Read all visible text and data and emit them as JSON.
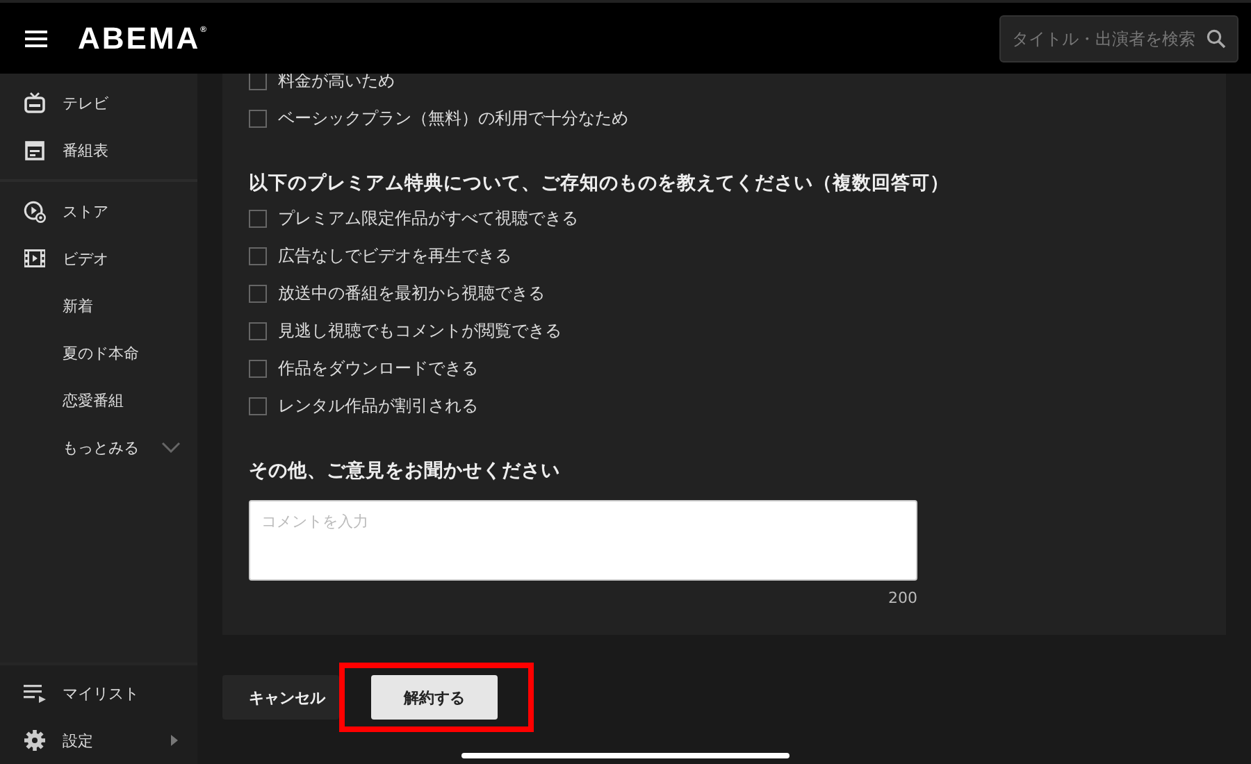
{
  "header": {
    "logo": "ABEMA$^{®}$",
    "search": {
      "placeholder": "タイトル・出演者を検索"
    }
  },
  "sidebar": {
    "sections": [
      {
        "items": [
          {
            "label": "テレビ",
            "kind": "main"
          },
          {
            "label": "番組表",
            "kind": "main"
          }
        ]
      },
      {
        "items": [
          {
            "label": "ストア",
            "kind": "main"
          },
          {
            "label": "ビデオ",
            "kind": "main"
          },
          {
            "label": "新着",
            "kind": "sub"
          },
          {
            "label": "夏のド本命",
            "kind": "sub"
          },
          {
            "label": "恋愛番組",
            "kind": "sub"
          },
          {
            "label": "もっとみる",
            "kind": "more",
            "expanded": false
          }
        ]
      }
    ],
    "footer_items": [
      {
        "label": "マイリスト",
        "submenu": false
      },
      {
        "label": "設定",
        "submenu": true
      }
    ]
  },
  "survey": {
    "reason_options": [
      {
        "label": "料金が高いため",
        "checked": false
      },
      {
        "label": "ベーシックプラン（無料）の利用で十分なため",
        "checked": false
      }
    ],
    "premium_question": {
      "heading": "以下のプレミアム特典について、ご存知のものを教えてください（複数回答可）",
      "options": [
        {
          "label": "プレミアム限定作品がすべて視聴できる",
          "checked": false
        },
        {
          "label": "広告なしでビデオを再生できる",
          "checked": false
        },
        {
          "label": "放送中の番組を最初から視聴できる",
          "checked": false
        },
        {
          "label": "見逃し視聴でもコメントが閲覧できる",
          "checked": false
        },
        {
          "label": "作品をダウンロードできる",
          "checked": false
        },
        {
          "label": "レンタル作品が割引される",
          "checked": false
        }
      ]
    },
    "comment": {
      "heading": "その他、ご意見をお聞かせください",
      "placeholder": "コメントを入力",
      "counter": "200"
    }
  },
  "buttons": {
    "cancel": "キャンセル",
    "confirm": "解約する"
  }
}
